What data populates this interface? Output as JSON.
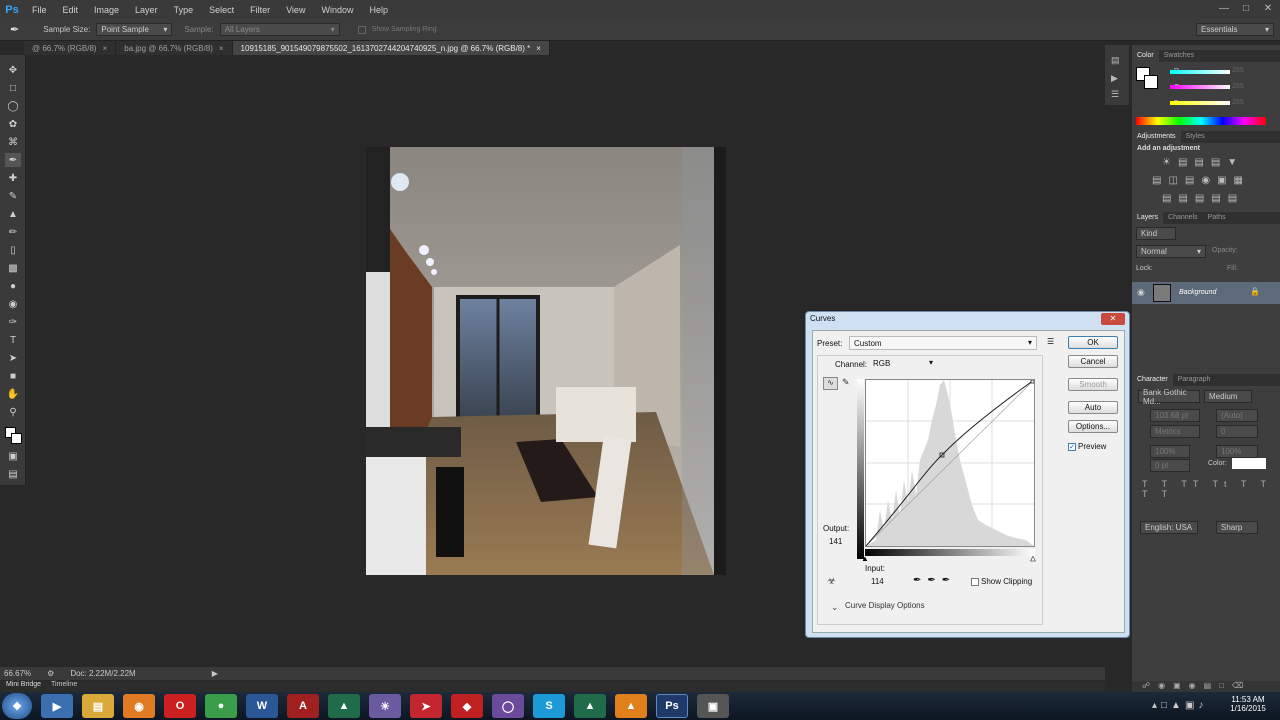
{
  "app": {
    "logo": "Ps"
  },
  "menu": [
    "File",
    "Edit",
    "Image",
    "Layer",
    "Type",
    "Select",
    "Filter",
    "View",
    "Window",
    "Help"
  ],
  "options": {
    "sample_size_label": "Sample Size:",
    "sample_size_value": "Point Sample",
    "sample_label": "Sample:",
    "sample_value": "All Layers",
    "show_ring_label": "Show Sampling Ring",
    "workspace": "Essentials"
  },
  "tabs": [
    {
      "label": "@ 66.7% (RGB/8)"
    },
    {
      "label": "ba.jpg @ 66.7% (RGB/8)"
    },
    {
      "label": "10915185_901549079875502_1613702744204740925_n.jpg @ 66.7% (RGB/8) *"
    }
  ],
  "status": {
    "zoom": "66.67%",
    "doc": "Doc: 2.22M/2.22M"
  },
  "bottom_tabs": [
    "Mini Bridge",
    "Timeline"
  ],
  "color_panel": {
    "tabs": [
      "Color",
      "Swatches"
    ],
    "channels": [
      {
        "label": "R",
        "value": "255"
      },
      {
        "label": "G",
        "value": "255"
      },
      {
        "label": "B",
        "value": "255"
      }
    ]
  },
  "adjustments": {
    "tabs": [
      "Adjustments",
      "Styles"
    ],
    "heading": "Add an adjustment"
  },
  "layers": {
    "tabs": [
      "Layers",
      "Channels",
      "Paths"
    ],
    "kind": "Kind",
    "blend": "Normal",
    "opacity_label": "Opacity:",
    "lock_label": "Lock:",
    "fill_label": "Fill:",
    "layer_name": "Background"
  },
  "character": {
    "tabs": [
      "Character",
      "Paragraph"
    ],
    "font": "Bank Gothic Md...",
    "style": "Medium",
    "size": "103.68 pt",
    "leading": "(Auto)",
    "kerning": "Metrics",
    "tracking": "0",
    "vscale": "100%",
    "hscale": "100%",
    "baseline": "0 pt",
    "color_label": "Color:",
    "language": "English: USA",
    "aa": "Sharp"
  },
  "curves": {
    "title": "Curves",
    "preset_label": "Preset:",
    "preset_value": "Custom",
    "channel_label": "Channel:",
    "channel_value": "RGB",
    "output_label": "Output:",
    "output_value": "141",
    "input_label": "Input:",
    "input_value": "114",
    "show_clipping": "Show Clipping",
    "display_options": "Curve Display Options",
    "buttons": {
      "ok": "OK",
      "cancel": "Cancel",
      "smooth": "Smooth",
      "auto": "Auto",
      "options": "Options..."
    },
    "preview_label": "Preview",
    "preview_checked": true
  },
  "clock": {
    "time": "11:53 AM",
    "date": "1/16/2015"
  },
  "taskbar": [
    "start",
    "media",
    "explorer",
    "firefox",
    "opera",
    "chrome",
    "word",
    "autocad",
    "sketchup",
    "lumion",
    "flash",
    "app",
    "torrent",
    "skype",
    "archicad",
    "vlc",
    "photoshop",
    "screen"
  ]
}
